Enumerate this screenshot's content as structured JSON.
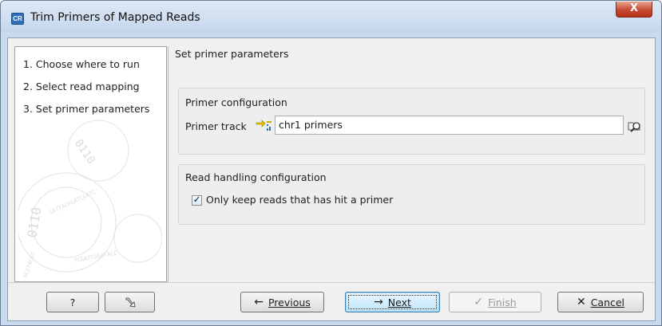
{
  "window": {
    "app_icon_text": "CR",
    "title": "Trim Primers of Mapped Reads",
    "close_glyph": "X"
  },
  "steps": [
    {
      "label": "1.  Choose where to run"
    },
    {
      "label": "2.  Select read mapping"
    },
    {
      "label": "3.  Set primer parameters"
    }
  ],
  "panel": {
    "header": "Set primer parameters",
    "primer_group": {
      "title": "Primer configuration",
      "field_label": "Primer track",
      "field_value": "chr1 primers",
      "track_icon": "annotation-track-icon",
      "browse_icon": "browse-folder-icon"
    },
    "read_group": {
      "title": "Read handling configuration",
      "checkbox_label": "Only keep reads that has hit a primer",
      "checked": true
    }
  },
  "footer": {
    "help_label": "?",
    "reset_icon": "reset-icon",
    "previous": {
      "glyph": "←",
      "label": "Previous"
    },
    "next": {
      "glyph": "→",
      "label": "Next"
    },
    "finish": {
      "glyph": "✓",
      "label": "Finish"
    },
    "cancel": {
      "glyph": "✕",
      "label": "Cancel"
    }
  }
}
